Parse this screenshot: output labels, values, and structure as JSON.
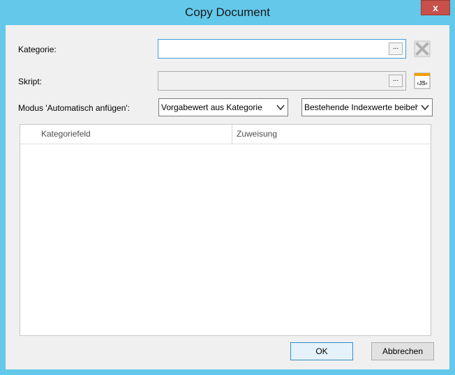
{
  "window": {
    "title": "Copy Document",
    "close_glyph": "x"
  },
  "form": {
    "category_label": "Kategorie:",
    "category_value": "",
    "script_label": "Skript:",
    "script_value": "",
    "browse_label": "...",
    "mode_label": "Modus 'Automatisch anfügen':",
    "mode_select_1": "Vorgabewert aus Kategorie",
    "mode_select_2": "Bestehende Indexwerte beibehalten"
  },
  "grid": {
    "columns": [
      "Kategoriefeld",
      "Zuweisung"
    ]
  },
  "buttons": {
    "ok": "OK",
    "cancel": "Abbrechen"
  },
  "icons": {
    "clear": "x-icon",
    "script": "js-script-icon",
    "dropdown": "chevron-down-icon"
  },
  "colors": {
    "titlebar": "#63c8ea",
    "close": "#c7504a",
    "focus_border": "#3c9fd6",
    "js_accent": "#f2a007"
  }
}
